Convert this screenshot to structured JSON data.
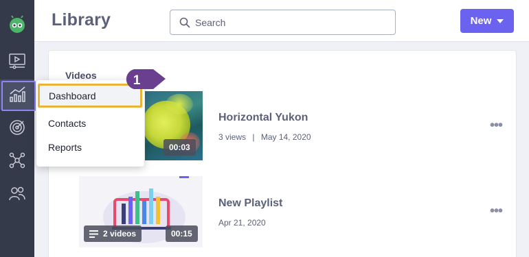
{
  "header": {
    "title": "Library",
    "search_placeholder": "Search",
    "new_button_label": "New"
  },
  "sidebar": {
    "items": [
      {
        "icon": "logo-icon"
      },
      {
        "icon": "video-player-icon"
      },
      {
        "icon": "analytics-icon",
        "active": true
      },
      {
        "icon": "target-icon"
      },
      {
        "icon": "network-icon"
      },
      {
        "icon": "contacts-icon"
      }
    ]
  },
  "nav_menu": {
    "items": [
      {
        "label": "Dashboard",
        "highlighted": true
      },
      {
        "label": "Contacts"
      },
      {
        "label": "Reports"
      }
    ]
  },
  "callout": {
    "number": "1"
  },
  "library": {
    "section_label": "Videos",
    "items": [
      {
        "title": "Horizontal Yukon",
        "views": "3 views",
        "separator": "|",
        "date": "May 14, 2020",
        "duration": "00:03"
      },
      {
        "title": "New Playlist",
        "date": "Apr 21, 2020",
        "video_count": "2 videos",
        "duration": "00:15"
      }
    ]
  },
  "colors": {
    "sidebar": "#343a49",
    "accent": "#6c62f0",
    "highlight_border": "#e8b43a",
    "callout": "#6a3f8f"
  }
}
